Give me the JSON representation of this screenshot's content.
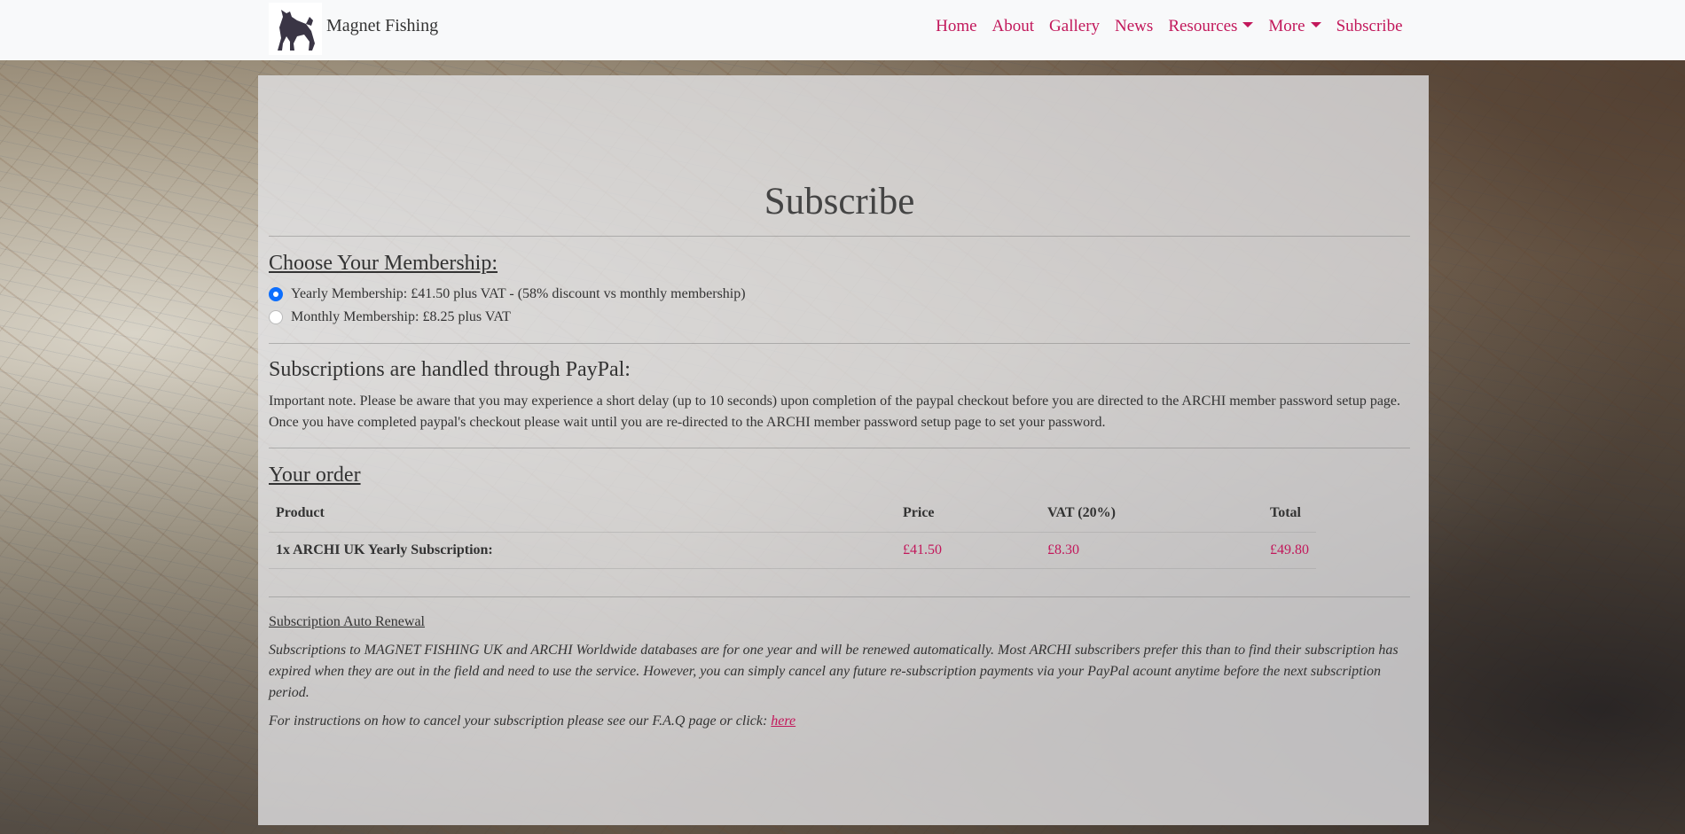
{
  "brand": {
    "name": "Magnet Fishing",
    "logo_icon": "dog-logo-icon"
  },
  "nav": {
    "items": [
      {
        "label": "Home"
      },
      {
        "label": "About"
      },
      {
        "label": "Gallery"
      },
      {
        "label": "News"
      },
      {
        "label": "Resources"
      },
      {
        "label": "More"
      },
      {
        "label": "Subscribe"
      }
    ]
  },
  "page": {
    "title": "Subscribe"
  },
  "membership": {
    "heading": "Choose Your Membership:",
    "options": [
      {
        "label": "Yearly Membership: £41.50 plus VAT - (58% discount vs monthly membership)",
        "checked": true
      },
      {
        "label": "Monthly Membership: £8.25 plus VAT",
        "checked": false
      }
    ]
  },
  "paypal": {
    "heading": "Subscriptions are handled through PayPal:",
    "note_line1": "Important note. Please be aware that you may experience a short delay (up to 10 seconds) upon completion of the paypal checkout before you are directed to the ARCHI member password setup page.",
    "note_line2": "Once you have completed paypal's checkout please wait until you are re-directed to the ARCHI member password setup page to set your password."
  },
  "order": {
    "heading": "Your order",
    "columns": [
      "Product",
      "Price",
      "VAT (20%)",
      "Total"
    ],
    "rows": [
      {
        "product": "1x ARCHI UK Yearly Subscription:",
        "price": "£41.50",
        "vat": "£8.30",
        "total": "£49.80"
      }
    ]
  },
  "renewal": {
    "heading": "Subscription Auto Renewal",
    "text": "Subscriptions to MAGNET FISHING UK and ARCHI Worldwide databases are for one year and will be renewed automatically. Most ARCHI subscribers prefer this than to find their subscription has expired when they are out in the field and need to use the service. However, you can simply cancel any future re-subscription payments via your PayPal acount anytime before the next subscription period.",
    "cancel_text": "For instructions on how to cancel your subscription please see our F.A.Q page or click: ",
    "cancel_link": "here"
  },
  "colors": {
    "accent": "#c2185b",
    "radio_checked": "#0d6efd",
    "navbar_bg": "#f8f9fa"
  }
}
